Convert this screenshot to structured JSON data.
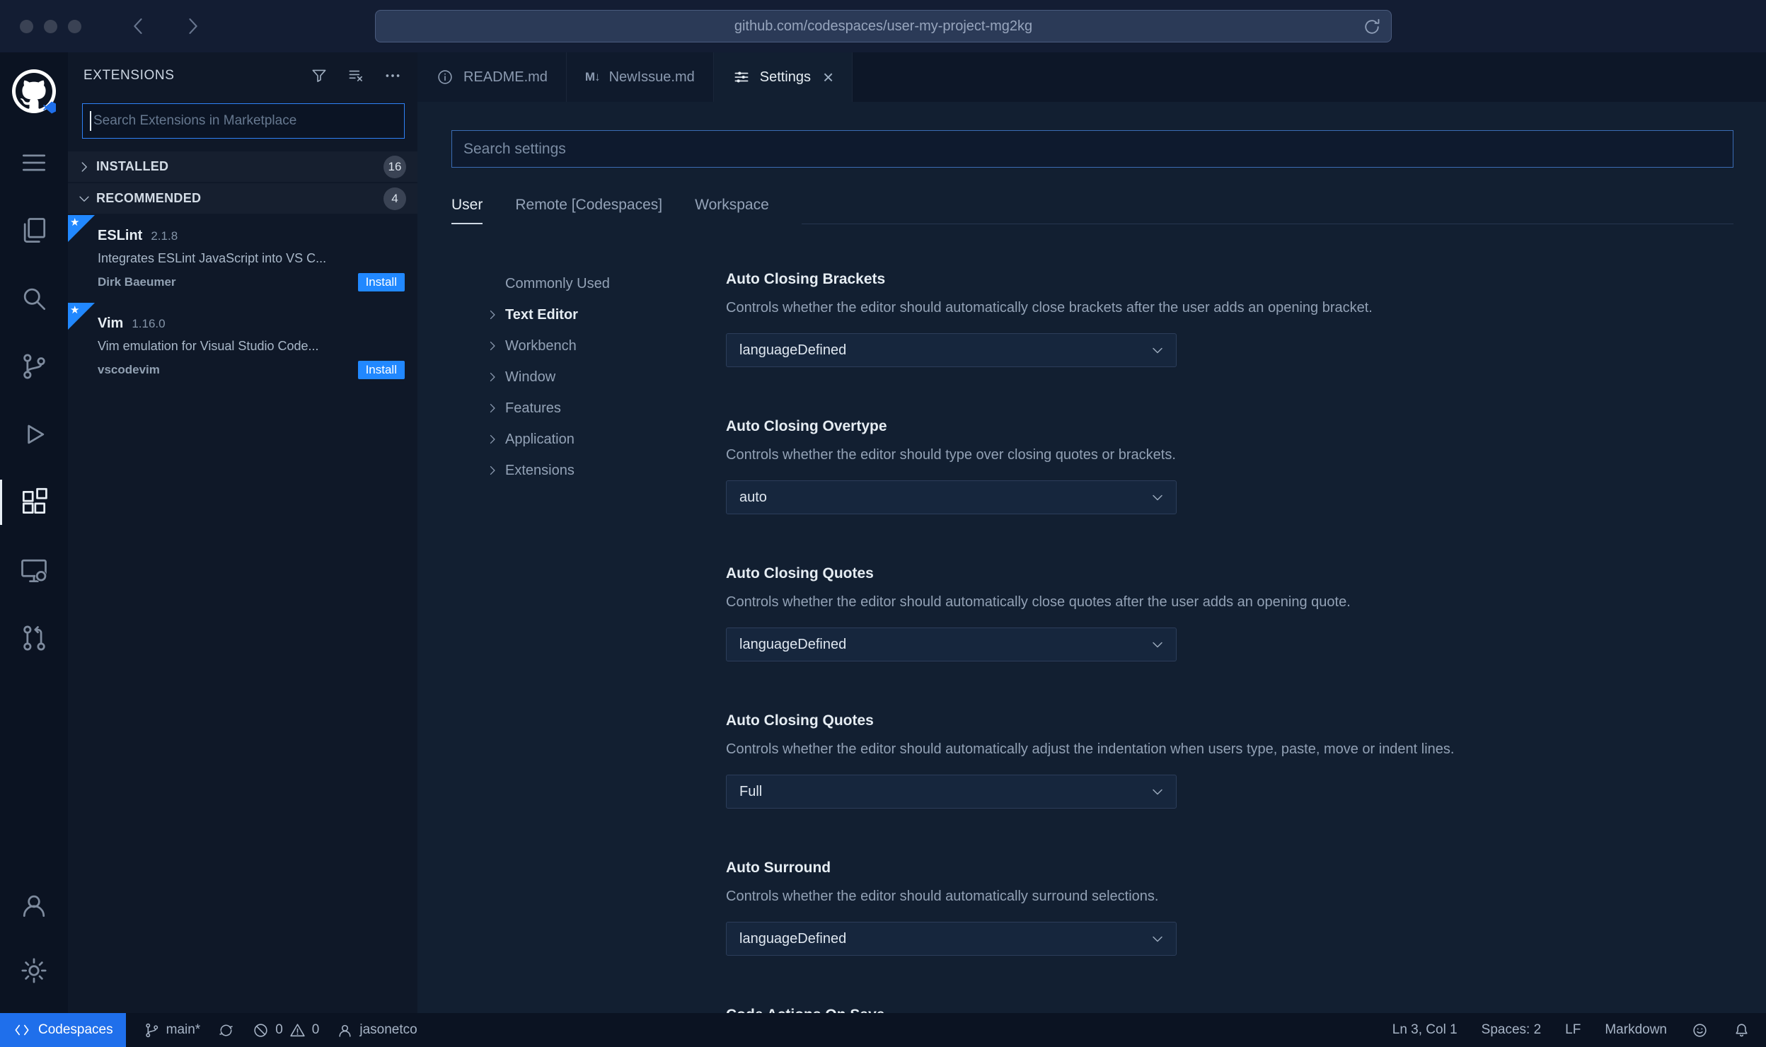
{
  "browser": {
    "url": "github.com/codespaces/user-my-project-mg2kg"
  },
  "icons": {
    "markdown_glyph": "M↓",
    "close_glyph": "×",
    "star_glyph": "★"
  },
  "sidebar": {
    "title": "EXTENSIONS",
    "search": {
      "placeholder": "Search Extensions in Marketplace",
      "value": ""
    },
    "sections": [
      {
        "label": "INSTALLED",
        "count": "16"
      },
      {
        "label": "RECOMMENDED",
        "count": "4"
      }
    ],
    "extensions": [
      {
        "name": "ESLint",
        "version": "2.1.8",
        "description": "Integrates ESLint JavaScript into VS C...",
        "publisher": "Dirk Baeumer",
        "action_label": "Install"
      },
      {
        "name": "Vim",
        "version": "1.16.0",
        "description": "Vim emulation for Visual Studio Code...",
        "publisher": "vscodevim",
        "action_label": "Install"
      }
    ]
  },
  "editor": {
    "tabs": [
      {
        "label": "README.md"
      },
      {
        "label": "NewIssue.md"
      },
      {
        "label": "Settings"
      }
    ]
  },
  "settings": {
    "search": {
      "placeholder": "Search settings",
      "value": ""
    },
    "scopes": [
      {
        "label": "User"
      },
      {
        "label": "Remote [Codespaces]"
      },
      {
        "label": "Workspace"
      }
    ],
    "toc": [
      {
        "label": "Commonly Used"
      },
      {
        "label": "Text Editor"
      },
      {
        "label": "Workbench"
      },
      {
        "label": "Window"
      },
      {
        "label": "Features"
      },
      {
        "label": "Application"
      },
      {
        "label": "Extensions"
      }
    ],
    "items": [
      {
        "title": "Auto Closing Brackets",
        "description": "Controls whether the editor should automatically close brackets after the user adds an opening bracket.",
        "value": "languageDefined"
      },
      {
        "title": "Auto Closing Overtype",
        "description": "Controls whether the editor should type over closing quotes or brackets.",
        "value": "auto"
      },
      {
        "title": "Auto Closing Quotes",
        "description": "Controls whether the editor should automatically close quotes after the user adds an opening quote.",
        "value": "languageDefined"
      },
      {
        "title": "Auto Closing Quotes",
        "description": "Controls whether the editor should automatically adjust the indentation when users type, paste, move or indent lines.",
        "value": "Full"
      },
      {
        "title": "Auto Surround",
        "description": "Controls whether the editor should automatically surround selections.",
        "value": "languageDefined"
      },
      {
        "title": "Code Actions On Save"
      }
    ]
  },
  "status_bar": {
    "codespaces_label": "Codespaces",
    "branch": "main*",
    "errors": "0",
    "warnings": "0",
    "user": "jasonetco",
    "line_col": "Ln 3, Col 1",
    "indentation": "Spaces: 2",
    "eol": "LF",
    "language": "Markdown"
  }
}
